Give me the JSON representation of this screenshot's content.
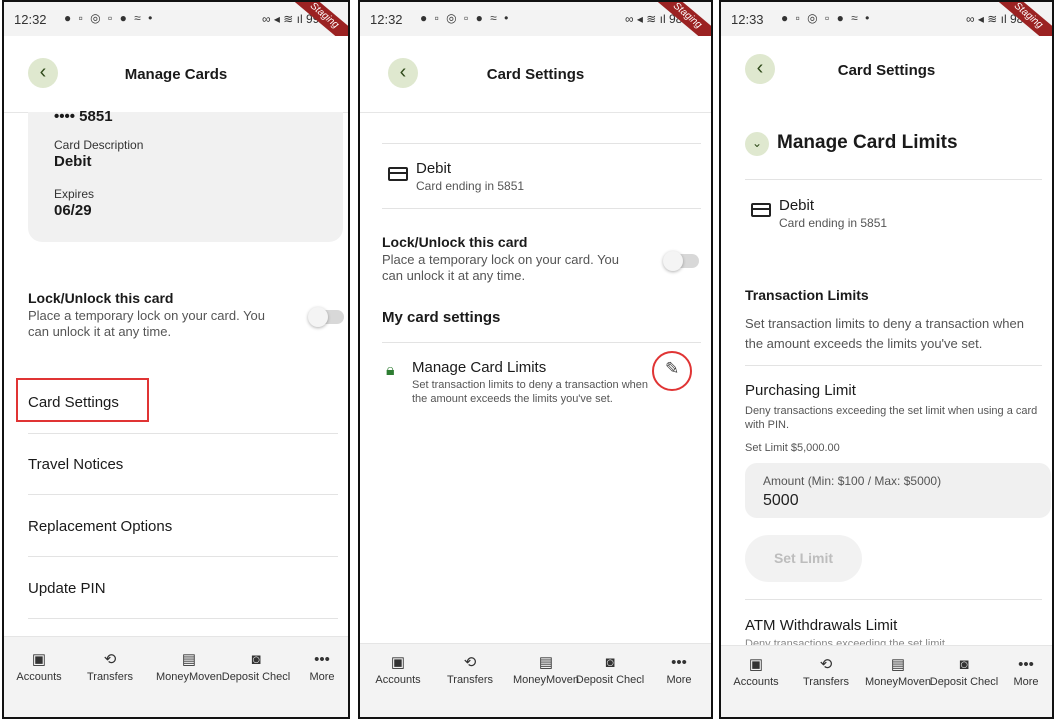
{
  "status": {
    "time1": "12:32",
    "time2": "12:32",
    "time3": "12:33",
    "battery1": "99%",
    "battery2": "98%",
    "battery3": "98%",
    "ribbon": "Staging"
  },
  "nav": {
    "items": [
      "Accounts",
      "Transfers",
      "MoneyMoven",
      "Deposit Checl",
      "More"
    ],
    "items3": [
      "Accounts",
      "Transfers",
      "MoneyMoven",
      "Deposit Checl",
      "More"
    ]
  },
  "screen1": {
    "title": "Manage Cards",
    "card_number": "•••• 5851",
    "desc_label": "Card Description",
    "desc_value": "Debit",
    "exp_label": "Expires",
    "exp_value": "06/29",
    "lock_title": "Lock/Unlock this card",
    "lock_desc": "Place a temporary lock on your card. You can unlock it at any time.",
    "menu": [
      "Card Settings",
      "Travel Notices",
      "Replacement Options",
      "Update PIN"
    ]
  },
  "screen2": {
    "title": "Card Settings",
    "card_name": "Debit",
    "card_sub": "Card ending in 5851",
    "lock_title": "Lock/Unlock this card",
    "lock_desc": "Place a temporary lock on your card. You can unlock it at any time.",
    "section": "My card settings",
    "limits_title": "Manage Card Limits",
    "limits_desc": "Set transaction limits to deny a transaction when the amount exceeds the limits you've set."
  },
  "screen3": {
    "title": "Card Settings",
    "heading": "Manage Card Limits",
    "card_name": "Debit",
    "card_sub": "Card ending in 5851",
    "tx_title": "Transaction Limits",
    "tx_desc": "Set transaction limits to deny a transaction when the amount exceeds the limits you've set.",
    "purch_title": "Purchasing Limit",
    "purch_desc": "Deny transactions exceeding the set limit when using a card with PIN.",
    "set_limit": "Set Limit $5,000.00",
    "amount_label": "Amount (Min: $100 / Max: $5000)",
    "amount_value": "5000",
    "set_btn": "Set Limit",
    "atm_title": "ATM Withdrawals Limit",
    "atm_desc": "Deny transactions exceeding the set limit"
  },
  "colors": {
    "highlight": "#e03434",
    "back_bg": "#dfe8cf",
    "lock_icon": "#2e7d32"
  }
}
